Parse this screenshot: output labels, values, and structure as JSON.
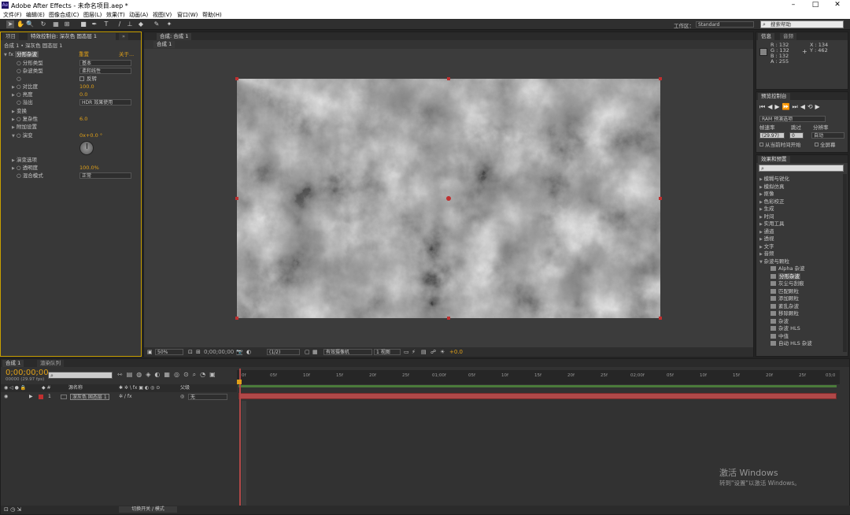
{
  "window": {
    "title": "Adobe After Effects - 未命名项目.aep *",
    "minimize": "–",
    "maximize": "□",
    "close": "✕",
    "app_icon": "Ae"
  },
  "menu": [
    "文件(F)",
    "编辑(E)",
    "图像合成(C)",
    "图层(L)",
    "效果(T)",
    "动画(A)",
    "视图(V)",
    "窗口(W)",
    "帮助(H)"
  ],
  "toolbar": {
    "workspace_label": "工作区：",
    "workspace_value": "Standard",
    "search_placeholder": "搜索帮助"
  },
  "effect_controls": {
    "tabs": [
      "项目",
      "特效控制台: 深灰色 固态层 1",
      "»"
    ],
    "header": "合成 1 • 深灰色 固态层 1",
    "effect_name": "分形杂波",
    "reset_label": "重置",
    "about_label": "关于...",
    "rows": [
      {
        "label": "分形类型",
        "type": "dropdown",
        "value": "基本"
      },
      {
        "label": "杂波类型",
        "type": "dropdown",
        "value": "柔和线性"
      },
      {
        "label": "",
        "type": "checkbox",
        "value": "反转"
      },
      {
        "label": "对比度",
        "type": "value",
        "value": "100.0"
      },
      {
        "label": "亮度",
        "type": "value",
        "value": "0.0"
      },
      {
        "label": "溢出",
        "type": "dropdown",
        "value": "HDR 效果使用"
      },
      {
        "label": "变换",
        "type": "group",
        "value": ""
      },
      {
        "label": "复杂性",
        "type": "value",
        "value": "6.0"
      },
      {
        "label": "附加设置",
        "type": "group",
        "value": ""
      },
      {
        "label": "演变",
        "type": "value",
        "value": "0x+0.0 °"
      },
      {
        "label": "演变选项",
        "type": "group",
        "value": ""
      },
      {
        "label": "透明度",
        "type": "value",
        "value": "100.0%"
      },
      {
        "label": "混合模式",
        "type": "dropdown",
        "value": "正常"
      }
    ]
  },
  "composition": {
    "tab_label": "合成: 合成 1",
    "subtab": "合成 1",
    "bottom_bar": {
      "zoom": "50%",
      "timecode": "0;00;00;00",
      "resolution": "(1/2)",
      "camera": "有效摄像机",
      "views": "1 视图",
      "exposure": "+0.0"
    }
  },
  "info_panel": {
    "tabs": [
      "信息",
      "音频"
    ],
    "r": "R : 132",
    "g": "G : 132",
    "b": "B : 132",
    "a": "A : 255",
    "x": "X : 134",
    "y": "Y : 462"
  },
  "preview_panel": {
    "tab": "预览控制台",
    "ram_label": "RAM 预演选项",
    "fps_label": "帧速率",
    "skip_label": "跳过",
    "res_label": "分辨率",
    "fps_value": "(29.97)",
    "skip_value": "0",
    "res_value": "自动",
    "from_current": "从当前时间开始",
    "full_screen": "全屏幕"
  },
  "effects_panel": {
    "tab": "效果和预置",
    "search_placeholder": "",
    "categories": [
      "模糊与锐化",
      "模拟仿真",
      "抠像",
      "色彩校正",
      "生成",
      "时间",
      "实用工具",
      "通道",
      "透视",
      "文字",
      "音频",
      "杂波与颗粒"
    ],
    "items": [
      "Alpha 杂波",
      "分形杂波",
      "灰尘与刮痕",
      "匹配颗粒",
      "添加颗粒",
      "紊乱杂波",
      "移除颗粒",
      "杂波",
      "杂波 HLS",
      "中值",
      "自动 HLS 杂波"
    ]
  },
  "timeline": {
    "tabs": [
      "合成 1",
      "渲染队列"
    ],
    "timecode": "0;00;00;00",
    "fps": "00000 (29.97 fps)",
    "search_placeholder": "",
    "header_cols": {
      "source_name": "源名称",
      "parent": "父级"
    },
    "layer": {
      "index": "1",
      "name": "深灰色 固态层 1",
      "parent": "无"
    },
    "ruler": [
      "0f",
      "05f",
      "10f",
      "15f",
      "20f",
      "25f",
      "01;00f",
      "05f",
      "10f",
      "15f",
      "20f",
      "25f",
      "02;00f",
      "05f",
      "10f",
      "15f",
      "20f",
      "25f",
      "03;0"
    ],
    "footer_toggle": "切换开关 / 模式"
  },
  "watermark": {
    "title": "激活 Windows",
    "subtitle": "转到\"设置\"以激活 Windows。"
  }
}
